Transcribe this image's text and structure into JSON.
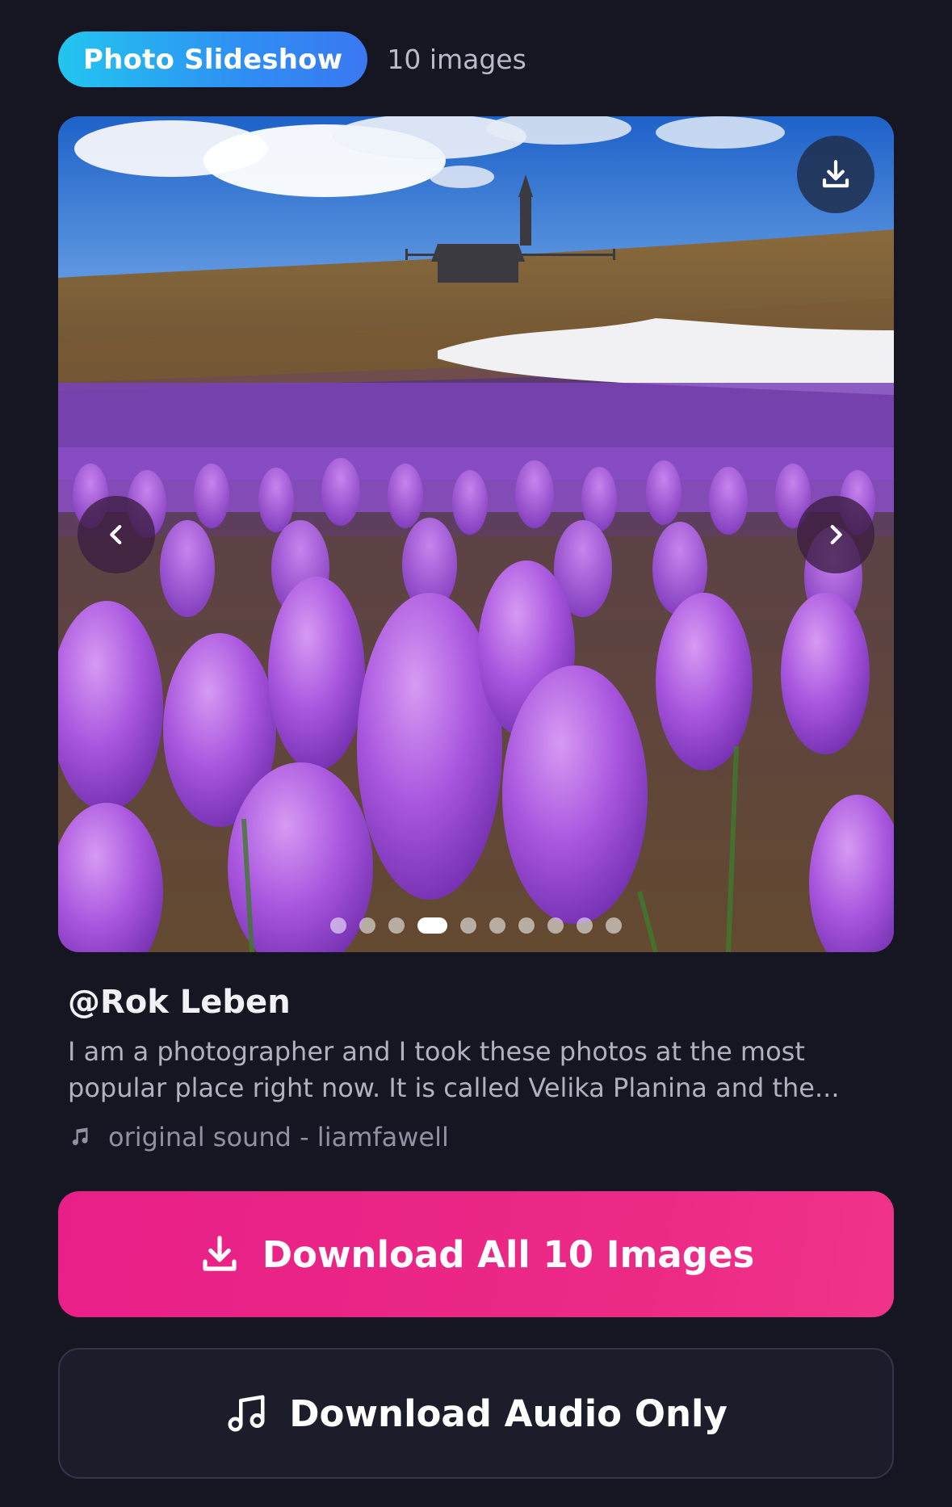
{
  "header": {
    "badge": "Photo Slideshow",
    "count": "10 images"
  },
  "slideshow": {
    "total_images": 10,
    "active_index": 3
  },
  "post": {
    "author": "@Rok Leben",
    "caption_line1": "I am a photographer and I took these photos at the most",
    "caption_line2": "popular place right now. It is called Velika Planina and the...",
    "sound": "original sound - liamfawell"
  },
  "actions": {
    "download_all": "Download All 10 Images",
    "download_audio": "Download Audio Only"
  },
  "colors": {
    "background": "#161622",
    "badge_gradient_start": "#22c6ef",
    "badge_gradient_end": "#3a78f2",
    "primary_button": "#e81f87",
    "secondary_button": "#1c1c2a"
  },
  "icons": [
    "download-icon",
    "chevron-left-icon",
    "chevron-right-icon",
    "music-note-icon"
  ]
}
